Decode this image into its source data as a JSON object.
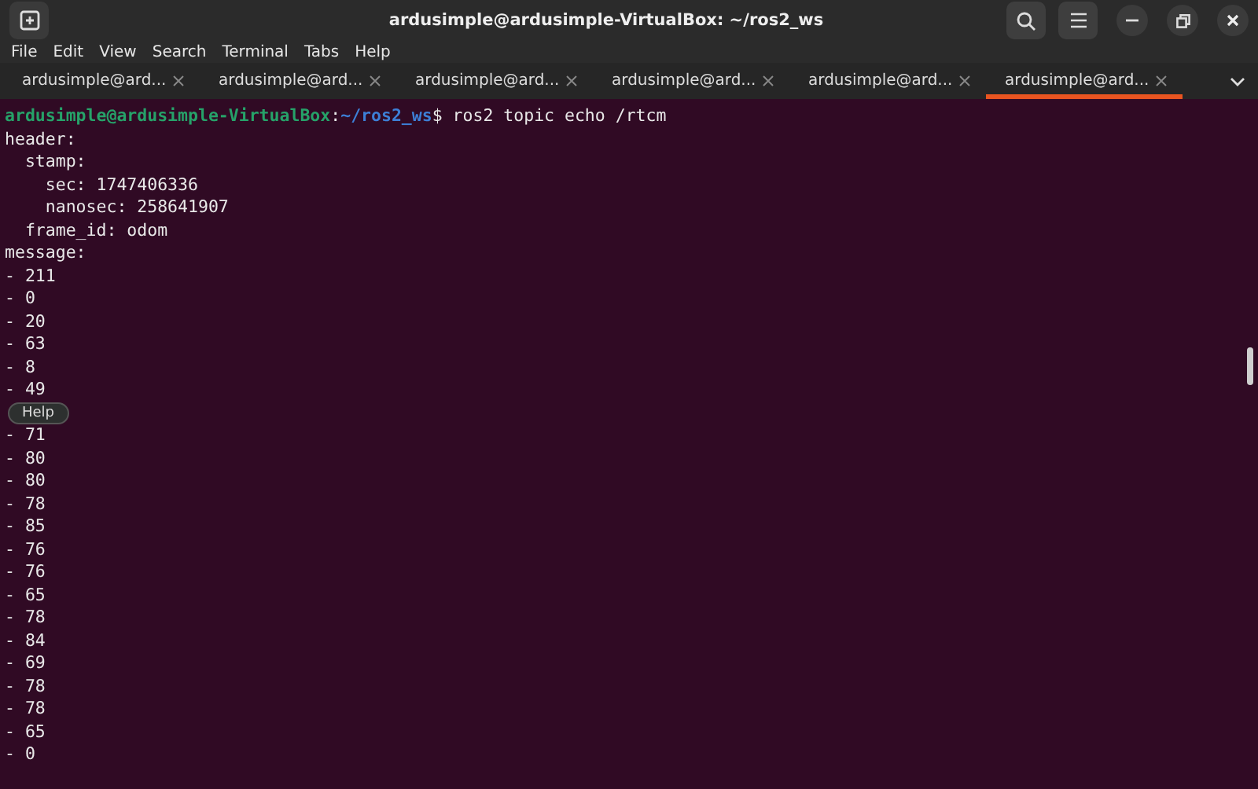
{
  "window": {
    "title": "ardusimple@ardusimple-VirtualBox: ~/ros2_ws"
  },
  "menu": [
    "File",
    "Edit",
    "View",
    "Search",
    "Terminal",
    "Tabs",
    "Help"
  ],
  "tabs": [
    {
      "label": "ardusimple@ard...",
      "selected": false
    },
    {
      "label": "ardusimple@ard...",
      "selected": false
    },
    {
      "label": "ardusimple@ard...",
      "selected": false
    },
    {
      "label": "ardusimple@ard...",
      "selected": false
    },
    {
      "label": "ardusimple@ard...",
      "selected": false
    },
    {
      "label": "ardusimple@ard...",
      "selected": true
    }
  ],
  "terminal": {
    "lines": [
      {
        "kind": "prompt",
        "user_host": "ardusimple@ardusimple-VirtualBox",
        "separator": ":",
        "path": "~/ros2_ws",
        "command": "$ ros2 topic echo /rtcm"
      },
      {
        "kind": "output",
        "text": "header:"
      },
      {
        "kind": "output",
        "text": "  stamp:"
      },
      {
        "kind": "output",
        "text": "    sec: 1747406336"
      },
      {
        "kind": "output",
        "text": "    nanosec: 258641907"
      },
      {
        "kind": "output",
        "text": "  frame_id: odom"
      },
      {
        "kind": "output",
        "text": "message:"
      },
      {
        "kind": "output",
        "text": "- 211"
      },
      {
        "kind": "output",
        "text": "- 0"
      },
      {
        "kind": "output",
        "text": "- 20"
      },
      {
        "kind": "output",
        "text": "- 63"
      },
      {
        "kind": "output",
        "text": "- 8"
      },
      {
        "kind": "output",
        "text": "- 49"
      },
      {
        "kind": "tooltip",
        "text": "Help"
      },
      {
        "kind": "output",
        "text": "- 71"
      },
      {
        "kind": "output",
        "text": "- 80"
      },
      {
        "kind": "output",
        "text": "- 80"
      },
      {
        "kind": "output",
        "text": "- 78"
      },
      {
        "kind": "output",
        "text": "- 85"
      },
      {
        "kind": "output",
        "text": "- 76"
      },
      {
        "kind": "output",
        "text": "- 76"
      },
      {
        "kind": "output",
        "text": "- 65"
      },
      {
        "kind": "output",
        "text": "- 78"
      },
      {
        "kind": "output",
        "text": "- 84"
      },
      {
        "kind": "output",
        "text": "- 69"
      },
      {
        "kind": "output",
        "text": "- 78"
      },
      {
        "kind": "output",
        "text": "- 78"
      },
      {
        "kind": "output",
        "text": "- 65"
      },
      {
        "kind": "output",
        "text": "- 0"
      }
    ]
  }
}
